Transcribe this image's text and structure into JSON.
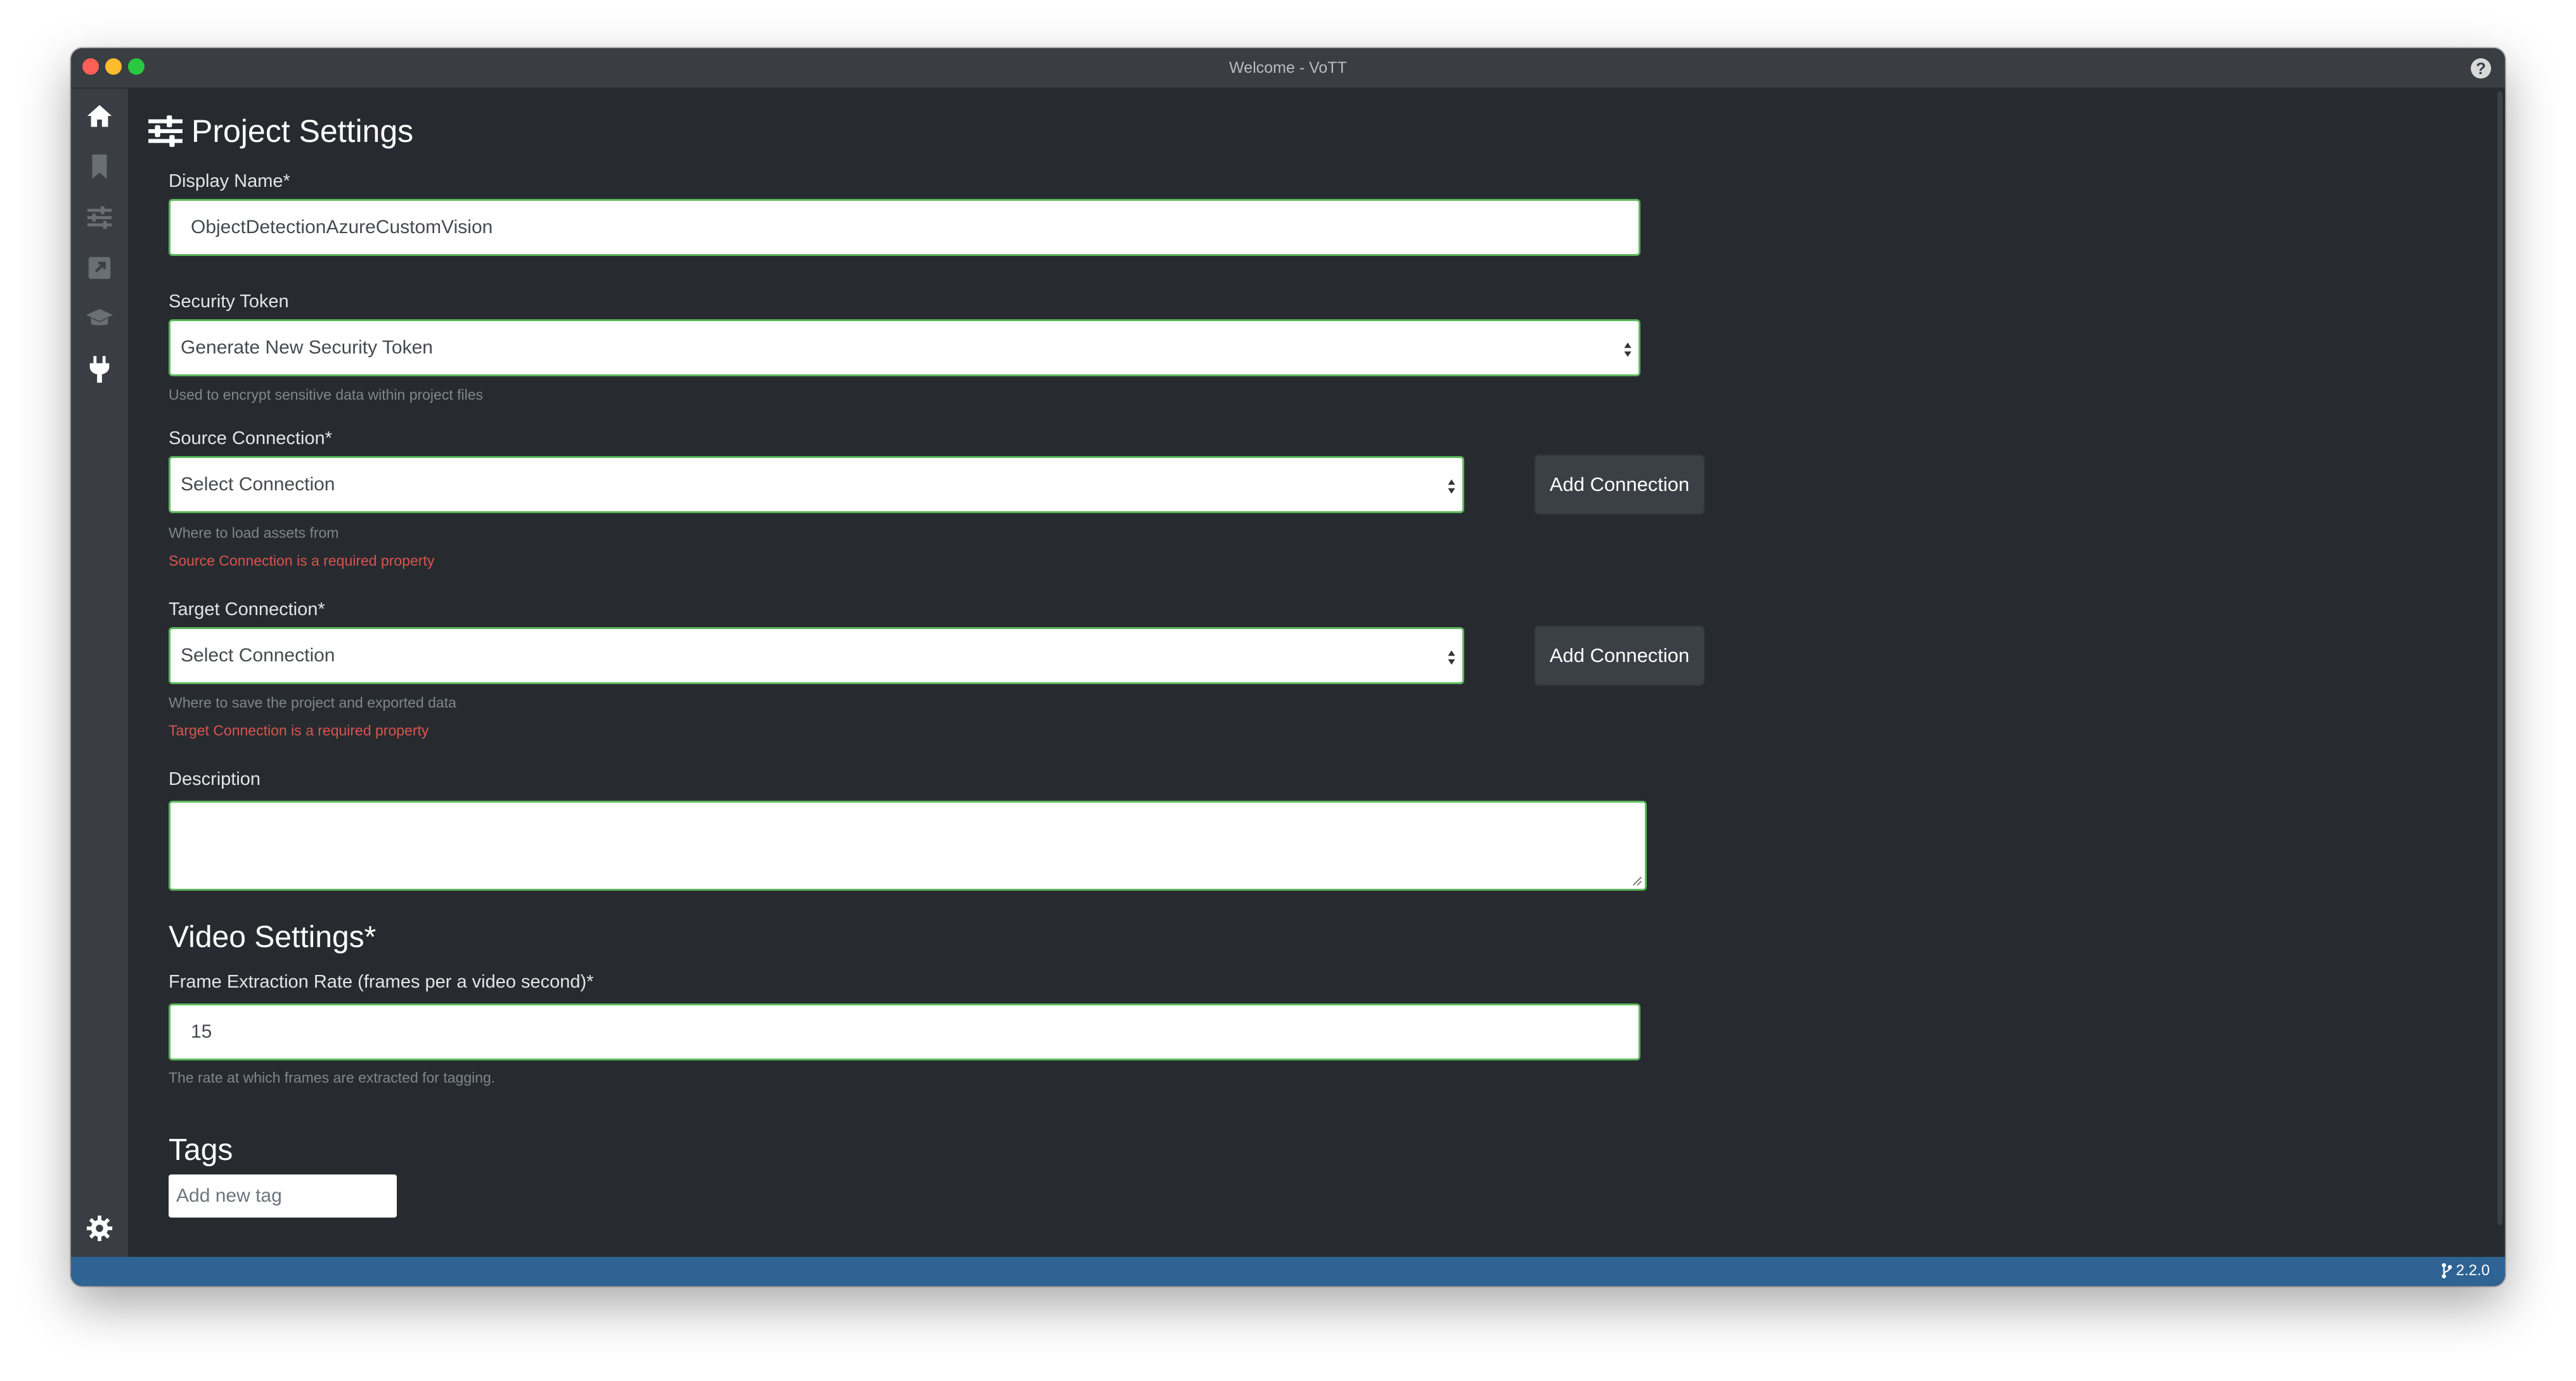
{
  "window": {
    "title": "Welcome - VoTT"
  },
  "sidebar": {
    "items": [
      {
        "name": "home-icon",
        "active": true
      },
      {
        "name": "bookmark-icon",
        "active": false
      },
      {
        "name": "sliders-icon",
        "active": false
      },
      {
        "name": "export-icon",
        "active": false
      },
      {
        "name": "graduation-cap-icon",
        "active": false
      },
      {
        "name": "plug-icon",
        "active": true
      },
      {
        "name": "gear-icon",
        "active": true
      }
    ]
  },
  "page": {
    "title": "Project Settings"
  },
  "form": {
    "display_name": {
      "label": "Display Name*",
      "value": "ObjectDetectionAzureCustomVision"
    },
    "security_token": {
      "label": "Security Token",
      "value": "Generate New Security Token",
      "help": "Used to encrypt sensitive data within project files"
    },
    "source_connection": {
      "label": "Source Connection*",
      "value": "Select Connection",
      "button": "Add Connection",
      "help": "Where to load assets from",
      "error": "Source Connection is a required property"
    },
    "target_connection": {
      "label": "Target Connection*",
      "value": "Select Connection",
      "button": "Add Connection",
      "help": "Where to save the project and exported data",
      "error": "Target Connection is a required property"
    },
    "description": {
      "label": "Description",
      "value": ""
    }
  },
  "video_settings": {
    "title": "Video Settings*",
    "frame_rate": {
      "label": "Frame Extraction Rate (frames per a video second)*",
      "value": "15",
      "help": "The rate at which frames are extracted for tagging."
    }
  },
  "tags": {
    "title": "Tags",
    "placeholder": "Add new tag"
  },
  "statusbar": {
    "version": "2.2.0"
  },
  "colors": {
    "accent_status": "#2e6393",
    "valid_border": "#5cb85c",
    "error": "#d9534f",
    "background": "#272b30"
  }
}
